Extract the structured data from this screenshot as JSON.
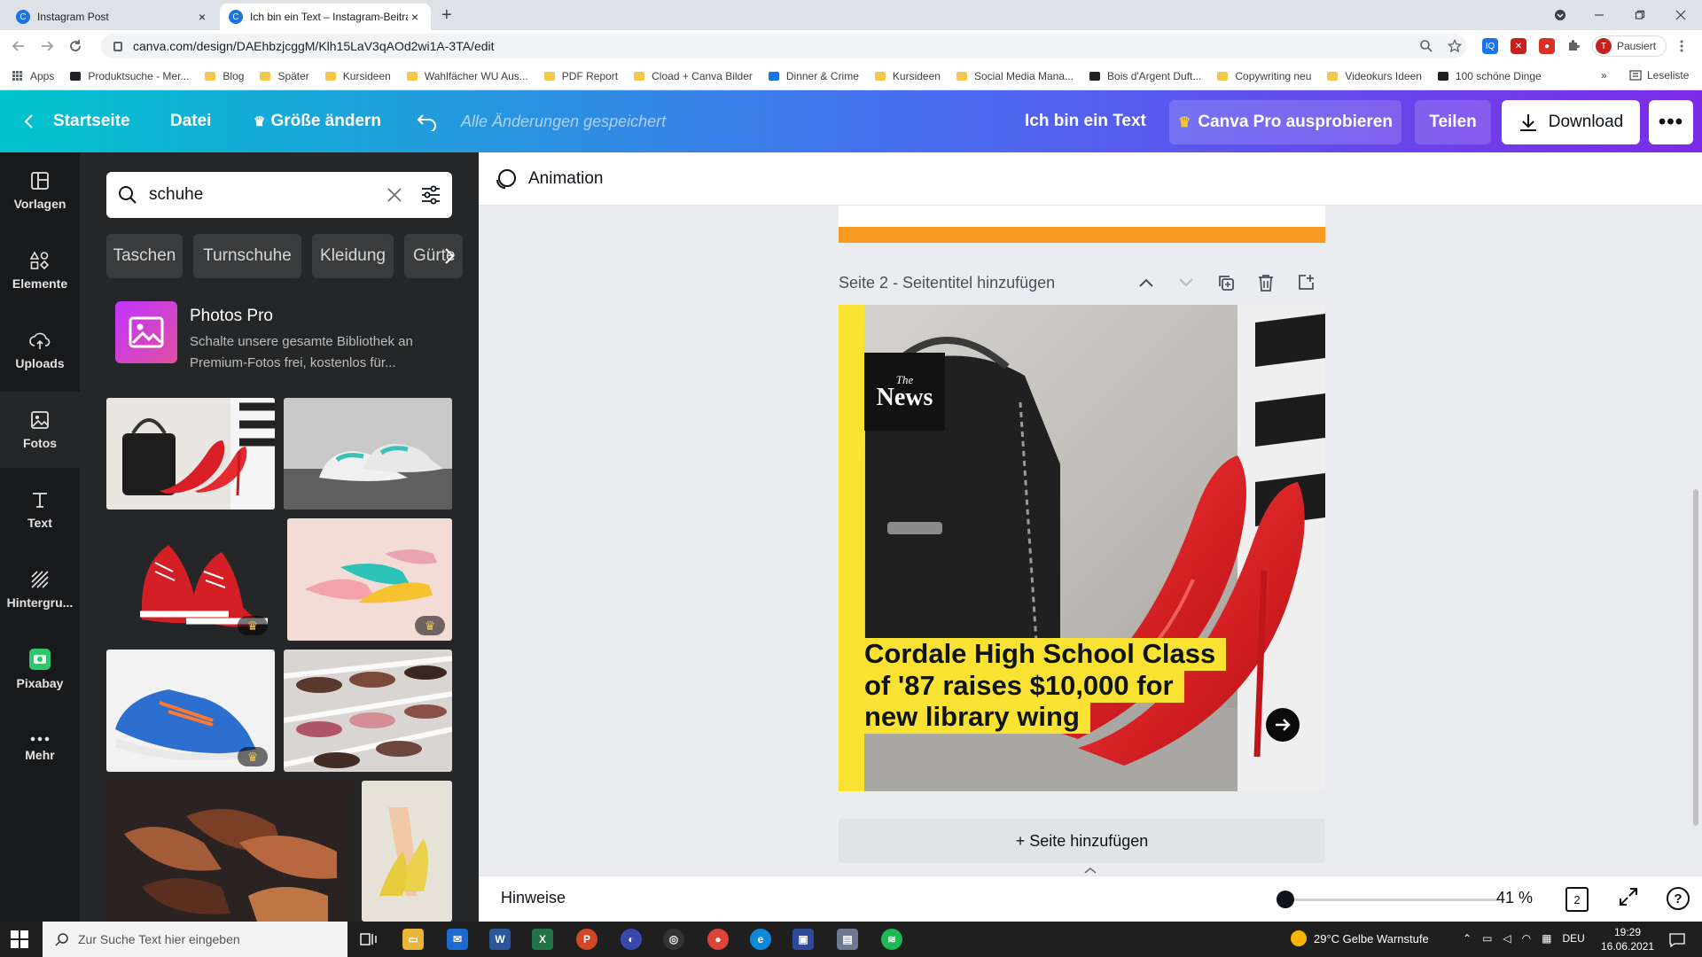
{
  "browser": {
    "tabs": [
      {
        "title": "Instagram Post",
        "close": "×",
        "active": false
      },
      {
        "title": "Ich bin ein Text – Instagram-Beitrag",
        "close": "×",
        "active": true
      }
    ],
    "new_tab": "+",
    "url": "canva.com/design/DAEhbzjcggM/Klh15LaV3qAOd2wi1A-3TA/edit",
    "profile_initial": "T",
    "profile_label": "Pausiert",
    "bookmarks": [
      {
        "label": "Apps",
        "icon": "apps-grid-icon"
      },
      {
        "label": "Produktsuche - Mer...",
        "icon": "bookmark-dark-icon"
      },
      {
        "label": "Blog",
        "icon": "folder-icon"
      },
      {
        "label": "Später",
        "icon": "folder-icon"
      },
      {
        "label": "Kursideen",
        "icon": "folder-icon"
      },
      {
        "label": "Wahlfächer WU Aus...",
        "icon": "folder-icon"
      },
      {
        "label": "PDF Report",
        "icon": "folder-icon"
      },
      {
        "label": "Cload + Canva Bilder",
        "icon": "folder-icon"
      },
      {
        "label": "Dinner & Crime",
        "icon": "bookmark-blue-icon"
      },
      {
        "label": "Kursideen",
        "icon": "folder-icon"
      },
      {
        "label": "Social Media Mana...",
        "icon": "folder-icon"
      },
      {
        "label": "Bois d'Argent Duft...",
        "icon": "bookmark-dark-icon"
      },
      {
        "label": "Copywriting neu",
        "icon": "folder-icon"
      },
      {
        "label": "Videokurs Ideen",
        "icon": "folder-icon"
      },
      {
        "label": "100 schöne Dinge",
        "icon": "bookmark-dark-icon"
      }
    ],
    "bookmarks_more": "»",
    "reading_list": "Leseliste"
  },
  "header": {
    "home": "Startseite",
    "file": "Datei",
    "resize": "Größe ändern",
    "saved_status": "Alle Änderungen gespeichert",
    "design_title": "Ich bin ein Text",
    "try_pro": "Canva Pro ausprobieren",
    "share": "Teilen",
    "download": "Download",
    "more": "•••"
  },
  "rail": [
    {
      "label": "Vorlagen",
      "icon": "templates-icon",
      "active": false
    },
    {
      "label": "Elemente",
      "icon": "elements-icon",
      "active": false
    },
    {
      "label": "Uploads",
      "icon": "upload-cloud-icon",
      "active": false
    },
    {
      "label": "Fotos",
      "icon": "photo-icon",
      "active": true
    },
    {
      "label": "Text",
      "icon": "text-icon",
      "active": false
    },
    {
      "label": "Hintergru...",
      "icon": "background-icon",
      "active": false
    },
    {
      "label": "Pixabay",
      "icon": "pixabay-icon",
      "active": false
    },
    {
      "label": "Mehr",
      "icon": "more-dots-icon",
      "active": false
    }
  ],
  "panel": {
    "search_value": "schuhe",
    "chips": [
      "Taschen",
      "Turnschuhe",
      "Kleidung",
      "Gürte"
    ],
    "promo_title": "Photos Pro",
    "promo_desc": "Schalte unsere gesamte Bibliothek an Premium-Fotos frei, kostenlos für..."
  },
  "toolbar": {
    "animation": "Animation"
  },
  "page": {
    "title": "Seite 2 - Seitentitel hinzufügen",
    "headline": "Cordale High School Class of '87 raises $10,000 for new library wing",
    "logo_small": "The",
    "logo_big": "News",
    "add_page": "+ Seite hinzufügen"
  },
  "bottombar": {
    "notes": "Hinweise",
    "zoom_percent": 41,
    "zoom_label": "41 %",
    "page_count": "2"
  },
  "taskbar": {
    "search_placeholder": "Zur Suche Text hier eingeben",
    "weather": "29°C  Gelbe Warnstufe",
    "lang": "DEU",
    "time": "19:29",
    "date": "16.06.2021"
  },
  "colors": {
    "accent_yellow": "#f9e231",
    "orange_bar": "#f69a22",
    "gradient_start": "#00c4cc",
    "gradient_end": "#7d2ae8"
  }
}
